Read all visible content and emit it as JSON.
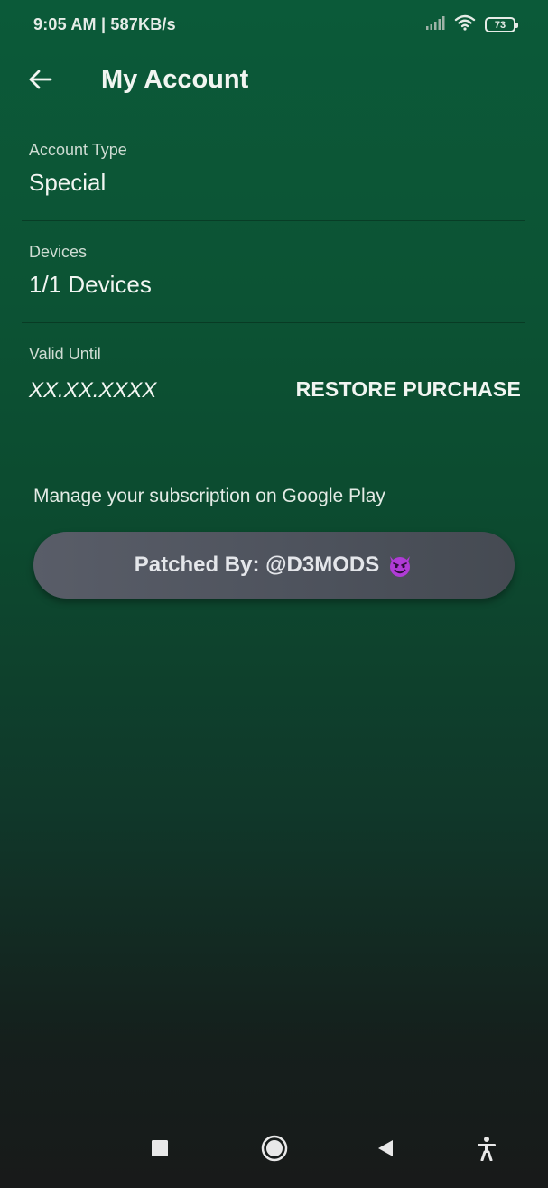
{
  "status_bar": {
    "time_speed": "9:05 AM | 587KB/s",
    "battery_level": "73",
    "icons": [
      "signal-icon",
      "wifi-icon",
      "battery-icon"
    ]
  },
  "app_bar": {
    "title": "My Account",
    "back_icon": "arrow-left-icon"
  },
  "account_type": {
    "label": "Account Type",
    "value": "Special"
  },
  "devices": {
    "label": "Devices",
    "value": "1/1 Devices"
  },
  "valid_until": {
    "label": "Valid Until",
    "value": "XX.XX.XXXX",
    "action_label": "RESTORE PURCHASE"
  },
  "subscription": {
    "manage_text": "Manage your subscription on Google Play",
    "patched_label": "Patched By: @D3MODS",
    "patched_icon": "devil-emoji-icon"
  },
  "nav_bar": {
    "icons": [
      "recents-square-icon",
      "home-circle-icon",
      "back-triangle-icon",
      "accessibility-icon"
    ]
  },
  "colors": {
    "background_top": "#0b5a39",
    "background_bottom": "#181a1a",
    "button_gray": "#555a64",
    "devil_purple": "#b03bd6"
  }
}
